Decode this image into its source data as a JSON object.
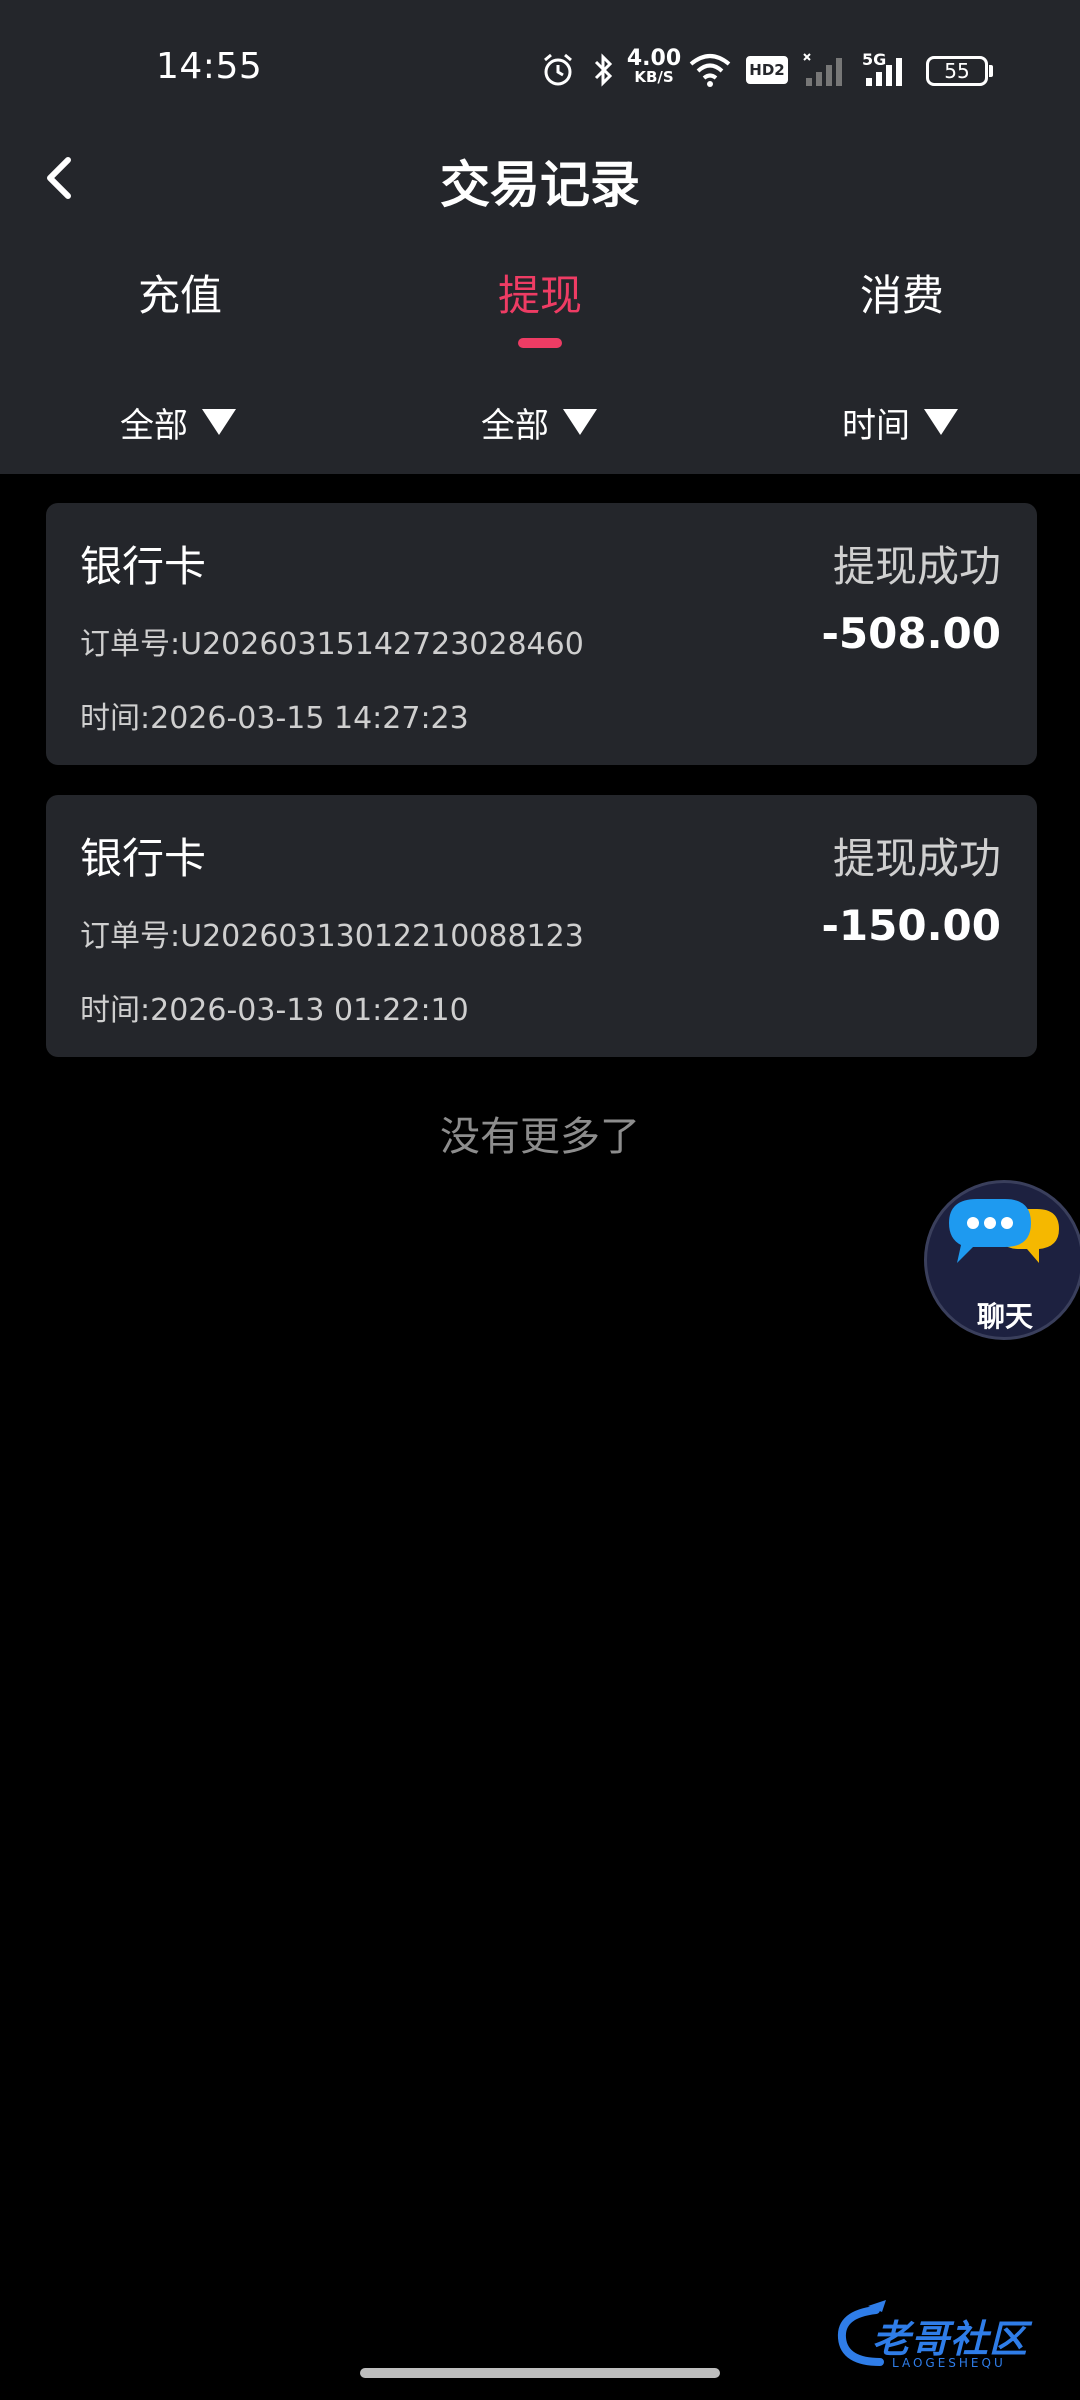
{
  "status_bar": {
    "time": "14:55",
    "net_speed_value": "4.00",
    "net_speed_unit": "KB/S",
    "hd_label": "HD2",
    "network_label": "5G",
    "battery": "55",
    "icons": [
      "alarm-icon",
      "bluetooth-icon",
      "wifi-icon",
      "hd-icon",
      "signal-icon",
      "battery-icon"
    ]
  },
  "header": {
    "title": "交易记录",
    "back_icon": "chevron-left-icon"
  },
  "tabs": [
    {
      "label": "充值",
      "active": false
    },
    {
      "label": "提现",
      "active": true
    },
    {
      "label": "消费",
      "active": false
    }
  ],
  "filters": [
    {
      "label": "全部"
    },
    {
      "label": "全部"
    },
    {
      "label": "时间"
    }
  ],
  "records": [
    {
      "type": "银行卡",
      "status": "提现成功",
      "order_label": "订单号:",
      "order_no": "U20260315142723028460",
      "time_label": "时间:",
      "time": "2026-03-15 14:27:23",
      "amount": "-508.00"
    },
    {
      "type": "银行卡",
      "status": "提现成功",
      "order_label": "订单号:",
      "order_no": "U20260313012210088123",
      "time_label": "时间:",
      "time": "2026-03-13 01:22:10",
      "amount": "-150.00"
    }
  ],
  "list_footer": "没有更多了",
  "chat_button": {
    "label": "聊天"
  },
  "watermark": {
    "text": "老哥社区",
    "subtext": "LAOGESHEQU"
  },
  "colors": {
    "accent": "#ee3c64",
    "panel": "#24262b",
    "background": "#000000"
  }
}
